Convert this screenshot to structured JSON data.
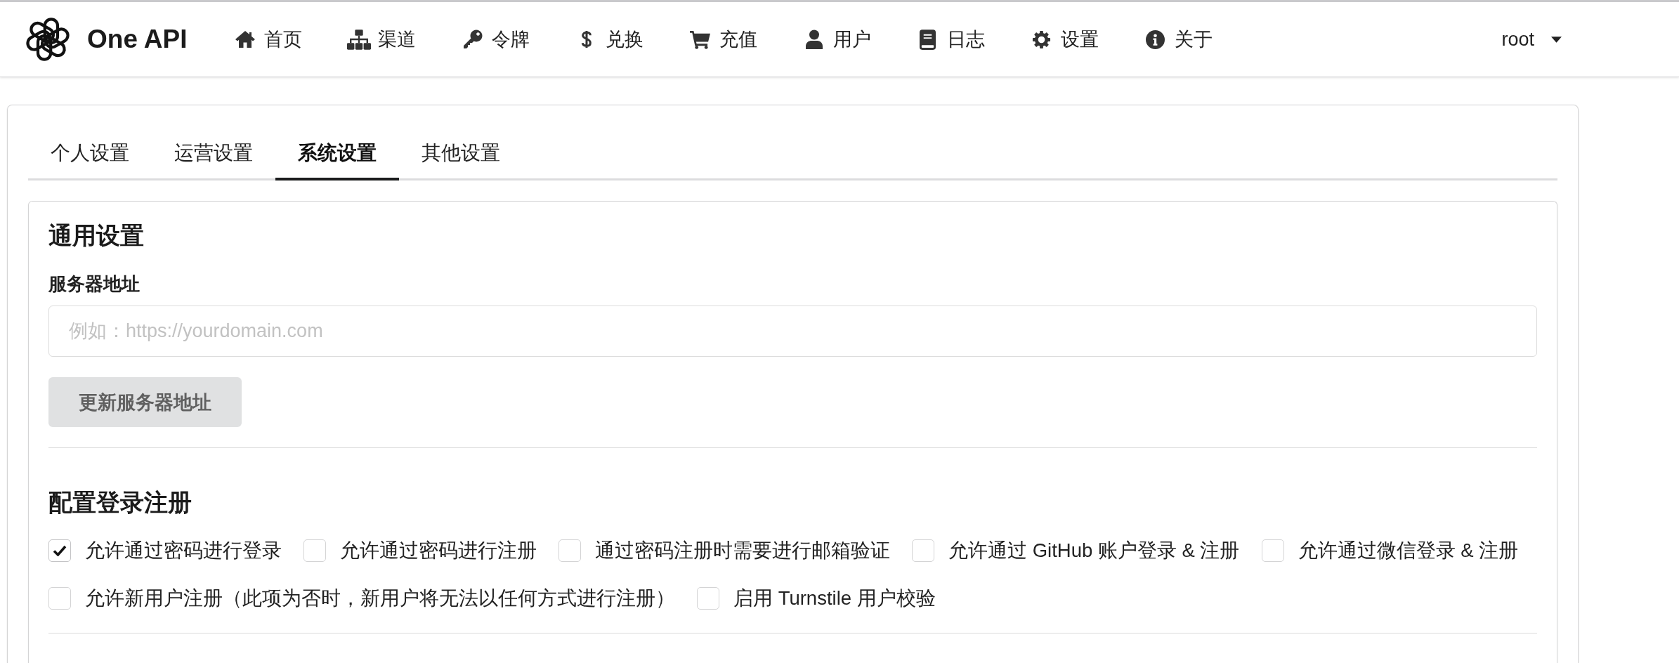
{
  "header": {
    "brand": "One API",
    "nav": [
      {
        "label": "首页"
      },
      {
        "label": "渠道"
      },
      {
        "label": "令牌"
      },
      {
        "label": "兑换"
      },
      {
        "label": "充值"
      },
      {
        "label": "用户"
      },
      {
        "label": "日志"
      },
      {
        "label": "设置"
      },
      {
        "label": "关于"
      }
    ],
    "user_menu": {
      "label": "root"
    }
  },
  "tabs": [
    {
      "label": "个人设置",
      "selected": false
    },
    {
      "label": "运营设置",
      "selected": false
    },
    {
      "label": "系统设置",
      "selected": true
    },
    {
      "label": "其他设置",
      "selected": false
    }
  ],
  "general_settings": {
    "title": "通用设置",
    "field": {
      "label": "服务器地址",
      "placeholder": "例如：https://yourdomain.com"
    },
    "button": "更新服务器地址"
  },
  "login_settings": {
    "title": "配置登录注册",
    "option_rows": [
      {
        "options": [
          {
            "label": "允许通过密码进行登录",
            "checked": true
          },
          {
            "label": "允许通过密码进行注册",
            "checked": false
          },
          {
            "label": "通过密码注册时需要进行邮箱验证",
            "checked": false
          },
          {
            "label": "允许通过 GitHub 账户登录 & 注册",
            "checked": false
          },
          {
            "label": "允许通过微信登录 & 注册",
            "checked": false
          }
        ]
      },
      {
        "options": [
          {
            "label": "允许新用户注册（此项为否时，新用户将无法以任何方式进行注册）",
            "checked": false
          },
          {
            "label": "启用 Turnstile 用户校验",
            "checked": false
          }
        ]
      }
    ]
  }
}
